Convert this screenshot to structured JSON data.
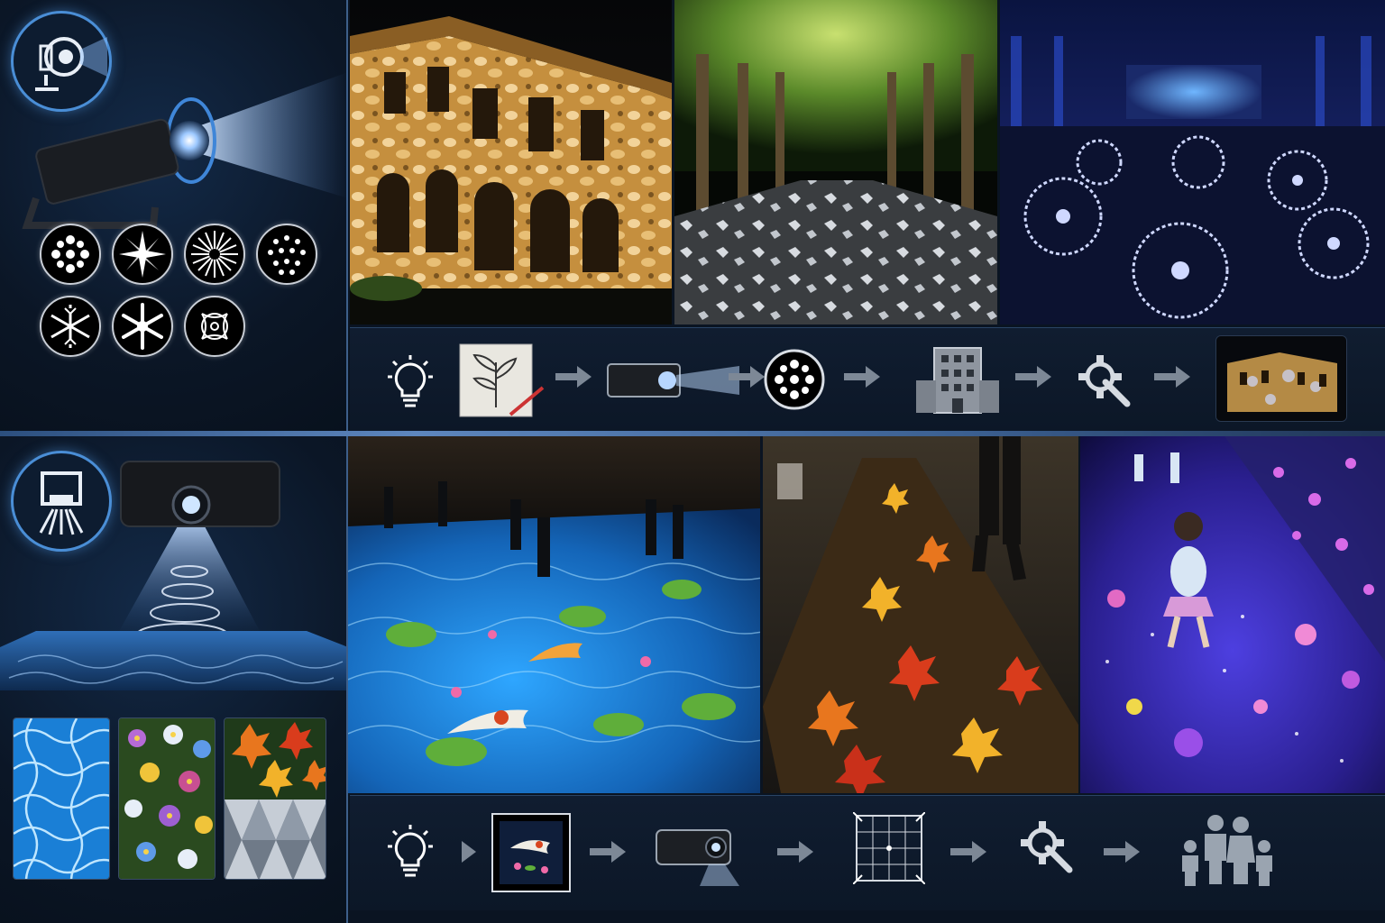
{
  "sections": [
    {
      "id": "gobo-projection",
      "badge_icon": "gobo-projector-icon",
      "fixture": "gobo-spotlight",
      "gobo_patterns": [
        "floral-mosaic-gobo-icon",
        "star-burst-gobo-icon",
        "radial-lines-gobo-icon",
        "dot-cluster-gobo-icon",
        "snowflake-gobo-icon",
        "ornate-snowflake-gobo-icon",
        "filigree-gobo-icon"
      ],
      "scenes": [
        "building-facade-scene",
        "tree-alley-scene",
        "ballroom-floor-scene"
      ],
      "workflow": [
        "lightbulb-idea-icon",
        "sketch-design-icon",
        "gobo-projector-icon",
        "gobo-disc-icon",
        "building-icon",
        "settings-wrench-icon",
        "finished-building-thumbnail"
      ]
    },
    {
      "id": "interactive-floor",
      "badge_icon": "ceiling-projector-icon",
      "fixture": "large-venue-projector",
      "textures": [
        "water-caustics-texture",
        "flower-field-texture",
        "autumn-leaves-texture",
        "geometric-triangles-texture"
      ],
      "scenes": [
        "koi-pond-floor-scene",
        "autumn-leaf-path-scene",
        "flower-galaxy-floor-scene"
      ],
      "workflow": [
        "lightbulb-idea-icon",
        "koi-content-icon",
        "projector-icon",
        "keystone-grid-icon",
        "settings-wrench-icon",
        "family-audience-icon"
      ]
    }
  ],
  "colors": {
    "accent_blue": "#4a8ed6",
    "panel_dark": "#0c1727",
    "warm_light": "#e8b05a",
    "water_blue": "#1e7fd0",
    "autumn_orange": "#e8761e",
    "violet_glow": "#7a3fd8"
  }
}
